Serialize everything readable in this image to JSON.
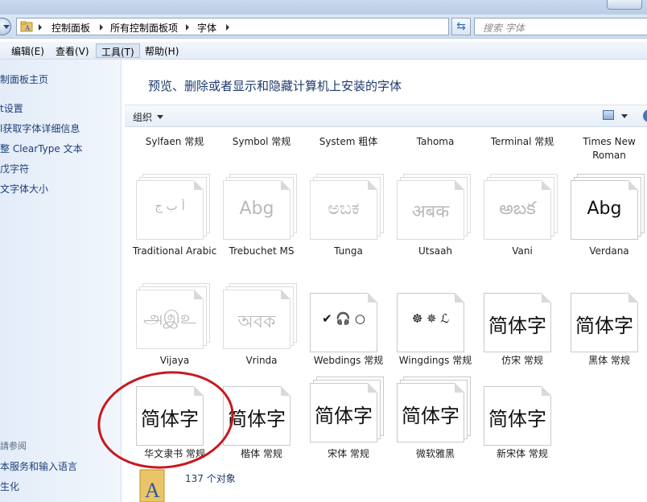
{
  "address": {
    "crumbs": [
      "控制面板",
      "所有控制面板项",
      "字体"
    ],
    "search_placeholder": "搜索 字体"
  },
  "menu": [
    {
      "label": "编辑(E)",
      "active": false
    },
    {
      "label": "查看(V)",
      "active": false
    },
    {
      "label": "工具(T)",
      "active": true
    },
    {
      "label": "帮助(H)",
      "active": false
    }
  ],
  "nav": {
    "links": [
      "制面板主页",
      "t设置",
      "l获取字体详细信息",
      "整 ClearType 文本",
      "戊字符",
      "文字体大小"
    ],
    "see_also": "請参阅",
    "bottom_links": [
      "本服务和输入语言",
      "生化"
    ]
  },
  "content": {
    "heading": "预览、删除或者显示和隐藏计算机上安装的字体",
    "organize": "组织",
    "status_text": "137 个对象"
  },
  "fonts": {
    "header_row": [
      "Sylfaen 常规",
      "Symbol 常规",
      "System 粗体",
      "Tahoma",
      "Terminal 常规",
      "Times New Roman"
    ],
    "rows": [
      [
        {
          "name": "Traditional Arabic",
          "sample": "أ ب ج",
          "faded": true,
          "stack": true
        },
        {
          "name": "Trebuchet MS",
          "sample": "Abg",
          "faded": true,
          "stack": true
        },
        {
          "name": "Tunga",
          "sample": "ಅಬಕ",
          "faded": true,
          "stack": true
        },
        {
          "name": "Utsaah",
          "sample": "अबक",
          "faded": true,
          "stack": true
        },
        {
          "name": "Vani",
          "sample": "అబక",
          "faded": true,
          "stack": true
        },
        {
          "name": "Verdana",
          "sample": "Abg",
          "faded": false,
          "stack": true
        }
      ],
      [
        {
          "name": "Vijaya",
          "sample": "அஇஉ",
          "faded": true,
          "stack": true
        },
        {
          "name": "Vrinda",
          "sample": "অবক",
          "faded": true,
          "stack": true
        },
        {
          "name": "Webdings 常规",
          "sample": "✔ 🎧 ○",
          "faded": false,
          "stack": false
        },
        {
          "name": "Wingdings 常规",
          "sample": "☸ ✵ ℒ",
          "faded": false,
          "stack": false
        },
        {
          "name": "仿宋 常规",
          "sample": "简体字",
          "faded": false,
          "stack": false
        },
        {
          "name": "黑体 常规",
          "sample": "简体字",
          "faded": false,
          "stack": false
        }
      ],
      [
        {
          "name": "华文隶书 常规",
          "sample": "简体字",
          "faded": false,
          "stack": false
        },
        {
          "name": "楷体 常规",
          "sample": "简体字",
          "faded": false,
          "stack": false
        },
        {
          "name": "宋体 常规",
          "sample": "简体字",
          "faded": false,
          "stack": true
        },
        {
          "name": "微软雅黑",
          "sample": "简体字",
          "faded": false,
          "stack": true
        },
        {
          "name": "新宋体 常规",
          "sample": "简体字",
          "faded": false,
          "stack": false
        }
      ]
    ]
  },
  "colors": {
    "annotation_circle": "#c8181e",
    "heading": "#1e3a6e",
    "nav_link": "#1d3f7a"
  }
}
